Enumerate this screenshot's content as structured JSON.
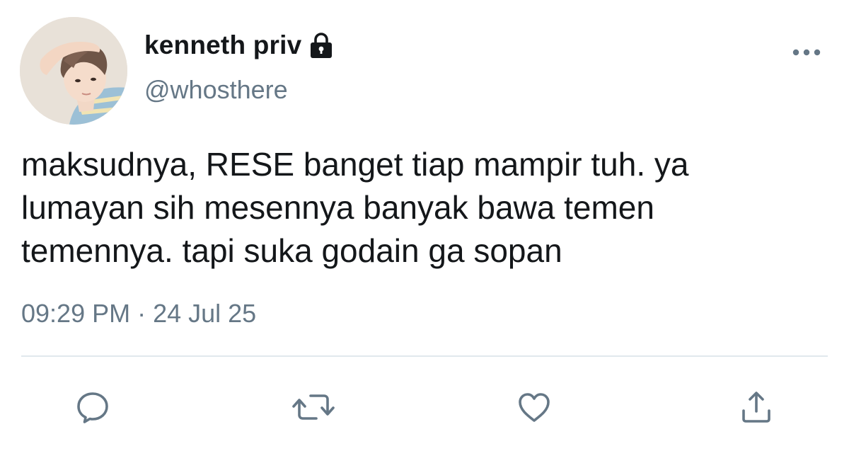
{
  "user": {
    "display_name": "kenneth priv",
    "handle": "@whosthere",
    "protected_icon": "lock-icon",
    "avatar_icon": "profile-photo"
  },
  "tweet": {
    "text": "maksudnya, RESE banget tiap mampir tuh. ya\nlumayan sih mesennya banyak bawa temen\ntemennya. tapi suka godain ga sopan",
    "timestamp": "09:29 PM · 24 Jul 25"
  },
  "actions": {
    "reply_icon": "speech-bubble-icon",
    "retweet_icon": "retweet-icon",
    "like_icon": "heart-icon",
    "share_icon": "share-upload-icon",
    "more_icon": "ellipsis-icon"
  },
  "colors": {
    "text_primary": "#14171a",
    "text_secondary": "#657786",
    "divider": "#e1e8ed",
    "background": "#ffffff"
  }
}
